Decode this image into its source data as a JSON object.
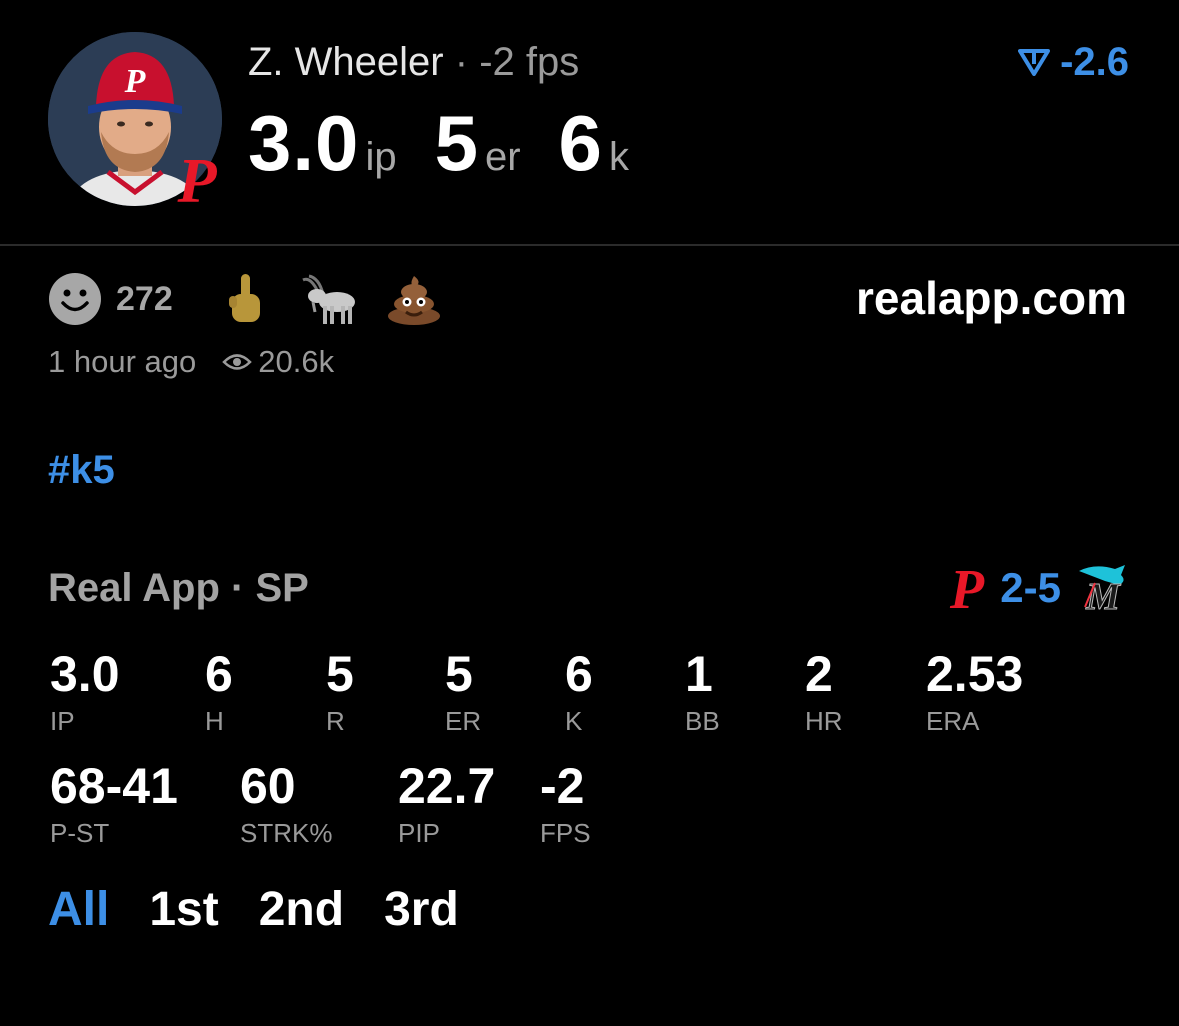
{
  "player": {
    "name": "Z. Wheeler",
    "separator": "·",
    "fps_text": "-2 fps",
    "rating": "-2.6",
    "big_stats": [
      {
        "value": "3.0",
        "unit": "ip"
      },
      {
        "value": "5",
        "unit": "er"
      },
      {
        "value": "6",
        "unit": "k"
      }
    ]
  },
  "reactions": {
    "count": "272",
    "emojis": [
      "smiley-face",
      "middle-finger",
      "goat",
      "poop"
    ]
  },
  "site": "realapp.com",
  "meta": {
    "time_ago": "1 hour ago",
    "views": "20.6k"
  },
  "hashtag": "#k5",
  "source_line": {
    "app": "Real App",
    "separator": "·",
    "position": "SP"
  },
  "game": {
    "score": "2-5"
  },
  "stats_row1": [
    {
      "value": "3.0",
      "label": "IP"
    },
    {
      "value": "6",
      "label": "H"
    },
    {
      "value": "5",
      "label": "R"
    },
    {
      "value": "5",
      "label": "ER"
    },
    {
      "value": "6",
      "label": "K"
    },
    {
      "value": "1",
      "label": "BB"
    },
    {
      "value": "2",
      "label": "HR"
    },
    {
      "value": "2.53",
      "label": "ERA"
    }
  ],
  "stats_row2": [
    {
      "value": "68-41",
      "label": "P-ST"
    },
    {
      "value": "60",
      "label": "STRK%"
    },
    {
      "value": "22.7",
      "label": "PIP"
    },
    {
      "value": "-2",
      "label": "FPS"
    }
  ],
  "tabs": [
    "All",
    "1st",
    "2nd",
    "3rd"
  ],
  "colors": {
    "accent": "#3d8fe6",
    "phillies_red": "#e81828",
    "background": "#000000"
  }
}
